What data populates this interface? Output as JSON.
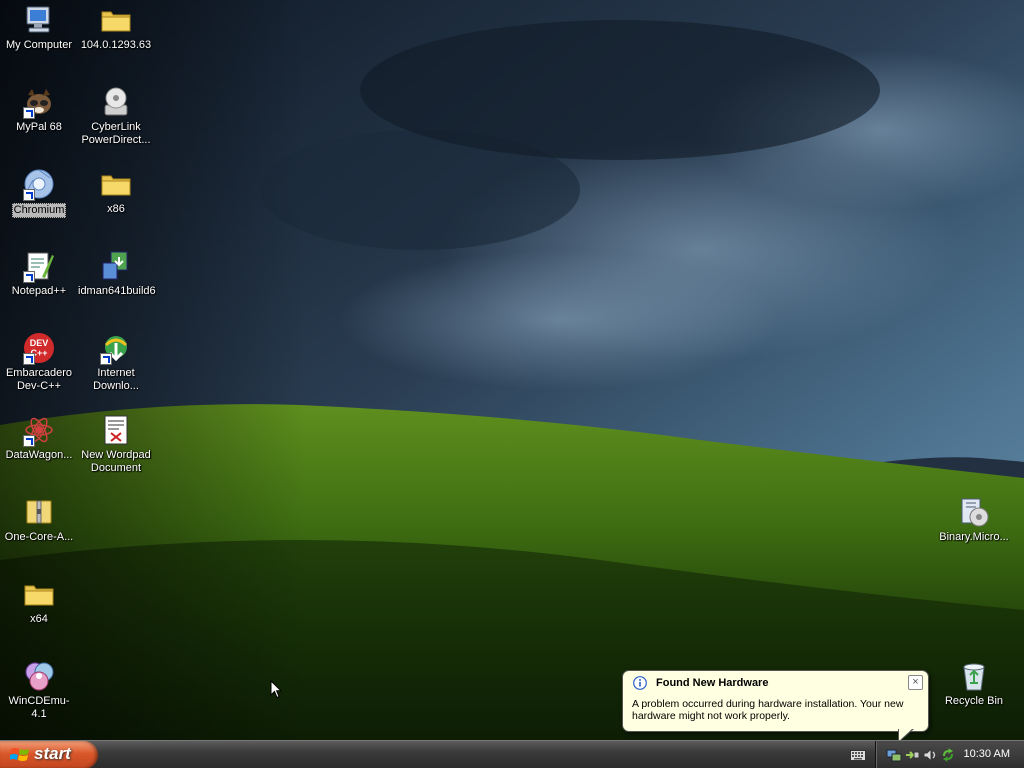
{
  "desktop": {
    "icons": [
      {
        "label": "My Computer",
        "type": "computer",
        "selected": false
      },
      {
        "label": "104.0.1293.63",
        "type": "folder",
        "selected": false
      },
      {
        "label": "MyPal 68",
        "type": "mypal",
        "selected": false
      },
      {
        "label": "CyberLink PowerDirect...",
        "type": "disc-installer",
        "selected": false
      },
      {
        "label": "Chromium",
        "type": "chromium",
        "selected": true
      },
      {
        "label": "x86",
        "type": "folder",
        "selected": false
      },
      {
        "label": "Notepad++",
        "type": "notepad",
        "selected": false
      },
      {
        "label": "idman641build6",
        "type": "installer",
        "selected": false
      },
      {
        "label": "Embarcadero Dev-C++",
        "type": "devcpp",
        "selected": false
      },
      {
        "label": "Internet Downlo...",
        "type": "idm",
        "selected": false
      },
      {
        "label": "DataWagon...",
        "type": "datawagon",
        "selected": false
      },
      {
        "label": "New Wordpad Document",
        "type": "wordpad-doc",
        "selected": false
      },
      {
        "label": "One-Core-A...",
        "type": "zip-folder",
        "selected": false
      },
      {
        "label": "x64",
        "type": "folder",
        "selected": false
      },
      {
        "label": "WinCDEmu-4.1",
        "type": "wincdemu",
        "selected": false
      },
      {
        "label": "Binary.Micro...",
        "type": "setup",
        "selected": false
      },
      {
        "label": "Recycle Bin",
        "type": "recycle-bin",
        "selected": false
      }
    ]
  },
  "taskbar": {
    "start_label": "start",
    "clock": "10:30 AM",
    "tray_icons": [
      "network-icon",
      "safely-remove-icon",
      "volume-icon",
      "update-icon"
    ]
  },
  "balloon": {
    "title": "Found New Hardware",
    "message": "A problem occurred during hardware installation. Your new hardware might not work properly.",
    "close_label": "×"
  },
  "colors": {
    "start_button": "#d9572a",
    "taskbar": "#3a3a3a",
    "balloon_bg": "#ffffe1"
  }
}
